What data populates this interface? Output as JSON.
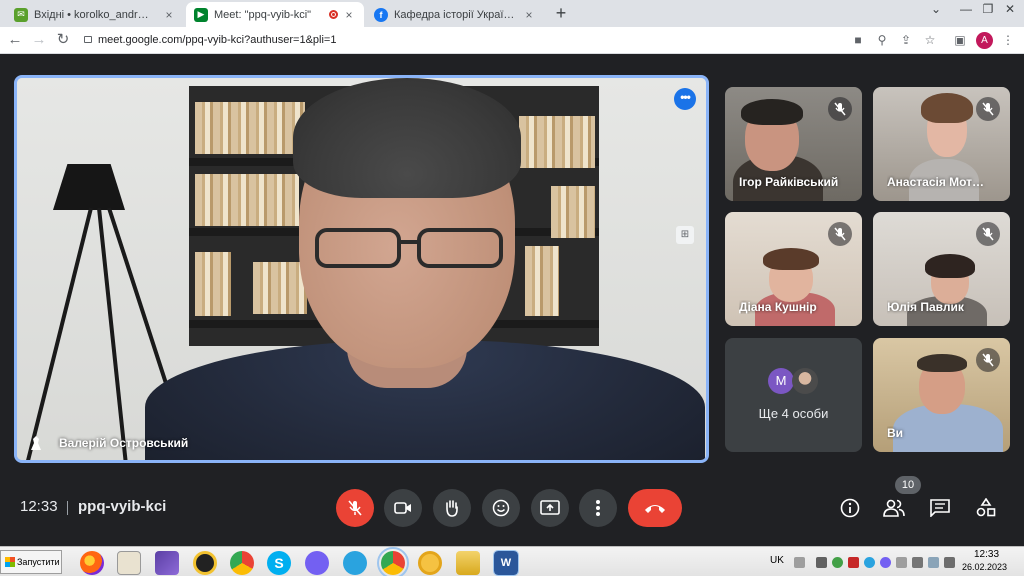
{
  "browser": {
    "tabs": [
      {
        "title": "Вхідні • korolko_andr@ukr.net",
        "close": "×"
      },
      {
        "title": "Meet: \"ppq-vyib-kci\"",
        "close": "×"
      },
      {
        "title": "Кафедра історії України і метод",
        "close": "×"
      }
    ],
    "new_tab": "+",
    "url": "meet.google.com/ppq-vyib-kci?authuser=1&pli=1",
    "profile_initial": "A"
  },
  "meet": {
    "main_speaker": "Валерій Островський",
    "participants": [
      {
        "name": "Ігор Райківський"
      },
      {
        "name": "Анастасія Мот…"
      },
      {
        "name": "Діана Кушнір"
      },
      {
        "name": "Юлія Павлик"
      },
      {
        "name": "Ви"
      }
    ],
    "others": {
      "avatar_initial": "M",
      "text": "Ще 4 особи"
    },
    "time": "12:33",
    "meeting_code": "ppq-vyib-kci",
    "people_count": "10"
  },
  "taskbar": {
    "start_label": "Запустити",
    "language": "UK",
    "clock_time": "12:33",
    "clock_date": "26.02.2023"
  },
  "colors": {
    "accent": "#8ab4f8",
    "hangup": "#ea4335",
    "meet_bg": "#202124",
    "tile_bg": "#3c4043"
  }
}
